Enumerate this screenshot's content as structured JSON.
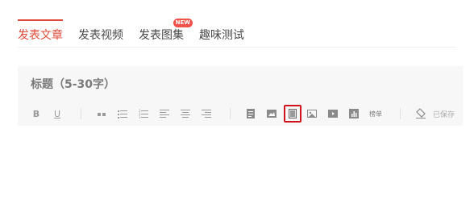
{
  "tabs": [
    {
      "label": "发表文章",
      "active": true
    },
    {
      "label": "发表视频",
      "active": false
    },
    {
      "label": "发表图集",
      "active": false,
      "badge": "NEW"
    },
    {
      "label": "趣味测试",
      "active": false
    }
  ],
  "editor": {
    "title_placeholder": "标题（5-30字）",
    "toolbar": {
      "bold_label": "B",
      "underline_label": "U",
      "list_label": "榜单",
      "save_status": "已保存"
    }
  },
  "colors": {
    "accent": "#e04a3a",
    "highlight": "#d0121c",
    "badge": "#f0524a"
  }
}
